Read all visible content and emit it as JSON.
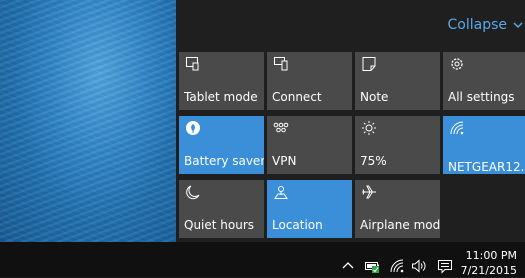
{
  "header": {
    "collapse_label": "Collapse"
  },
  "tiles": [
    {
      "label": "Tablet mode",
      "icon": "tablet-mode-icon",
      "active": false
    },
    {
      "label": "Connect",
      "icon": "connect-icon",
      "active": false
    },
    {
      "label": "Note",
      "icon": "note-icon",
      "active": false
    },
    {
      "label": "All settings",
      "icon": "settings-gear-icon",
      "active": false
    },
    {
      "label": "Battery saver",
      "icon": "battery-saver-icon",
      "active": true
    },
    {
      "label": "VPN",
      "icon": "vpn-icon",
      "active": false
    },
    {
      "label": "75%",
      "icon": "brightness-icon",
      "active": false
    },
    {
      "label": "NETGEAR12...",
      "icon": "wifi-icon",
      "active": true
    },
    {
      "label": "Quiet hours",
      "icon": "moon-icon",
      "active": false
    },
    {
      "label": "Location",
      "icon": "location-icon",
      "active": true
    },
    {
      "label": "Airplane mode",
      "icon": "airplane-icon",
      "active": false
    }
  ],
  "taskbar": {
    "tray_icons": [
      "chevron-up-icon",
      "battery-icon",
      "wifi-icon",
      "volume-icon",
      "notification-icon"
    ],
    "time": "11:00 PM",
    "date": "7/21/2015"
  },
  "colors": {
    "accent": "#3a8fd8",
    "tile": "#4a4a4a",
    "panel": "#1f1f1f",
    "link": "#5aa9e6"
  }
}
